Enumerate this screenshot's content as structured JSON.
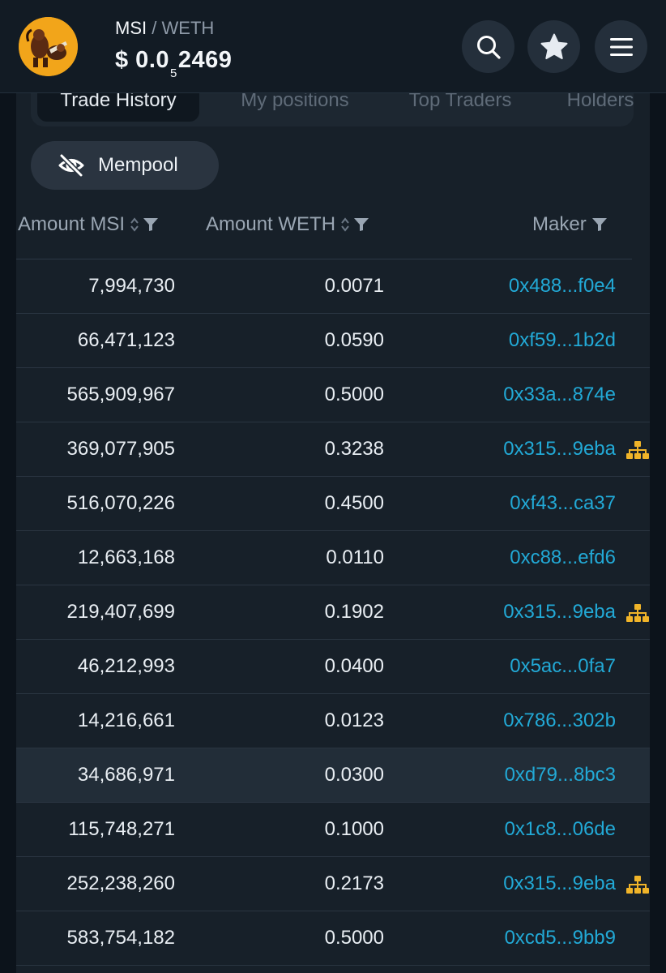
{
  "header": {
    "pair_base": "MSI",
    "pair_sep": "/",
    "pair_quote": "WETH",
    "price_prefix": "$ 0.0",
    "price_zeros": "5",
    "price_digits": "2469"
  },
  "tabs": [
    {
      "label": "Trade History",
      "active": true
    },
    {
      "label": "My positions",
      "active": false
    },
    {
      "label": "Top Traders",
      "active": false
    },
    {
      "label": "Holders",
      "active": false
    }
  ],
  "mempool": {
    "label": "Mempool"
  },
  "columns": {
    "amount_token": "Amount MSI",
    "amount_quote": "Amount WETH",
    "maker": "Maker"
  },
  "rows": [
    {
      "amount_token": "7,994,730",
      "amount_quote": "0.0071",
      "maker": "0x488...f0e4",
      "tree": false
    },
    {
      "amount_token": "66,471,123",
      "amount_quote": "0.0590",
      "maker": "0xf59...1b2d",
      "tree": false
    },
    {
      "amount_token": "565,909,967",
      "amount_quote": "0.5000",
      "maker": "0x33a...874e",
      "tree": false
    },
    {
      "amount_token": "369,077,905",
      "amount_quote": "0.3238",
      "maker": "0x315...9eba",
      "tree": true
    },
    {
      "amount_token": "516,070,226",
      "amount_quote": "0.4500",
      "maker": "0xf43...ca37",
      "tree": false
    },
    {
      "amount_token": "12,663,168",
      "amount_quote": "0.0110",
      "maker": "0xc88...efd6",
      "tree": false
    },
    {
      "amount_token": "219,407,699",
      "amount_quote": "0.1902",
      "maker": "0x315...9eba",
      "tree": true
    },
    {
      "amount_token": "46,212,993",
      "amount_quote": "0.0400",
      "maker": "0x5ac...0fa7",
      "tree": false
    },
    {
      "amount_token": "14,216,661",
      "amount_quote": "0.0123",
      "maker": "0x786...302b",
      "tree": false
    },
    {
      "amount_token": "34,686,971",
      "amount_quote": "0.0300",
      "maker": "0xd79...8bc3",
      "tree": false,
      "highlighted": true
    },
    {
      "amount_token": "115,748,271",
      "amount_quote": "0.1000",
      "maker": "0x1c8...06de",
      "tree": false
    },
    {
      "amount_token": "252,238,260",
      "amount_quote": "0.2173",
      "maker": "0x315...9eba",
      "tree": true
    },
    {
      "amount_token": "583,754,182",
      "amount_quote": "0.5000",
      "maker": "0xcd5...9bb9",
      "tree": false
    }
  ],
  "icons": {
    "search": "search-icon",
    "star": "star-icon",
    "menu": "menu-icon",
    "eye_off": "eye-off-icon",
    "sort": "sort-icon",
    "filter": "filter-icon",
    "tree": "wallet-tree-icon"
  },
  "colors": {
    "maker_link": "#22a9d6",
    "tree_icon": "#f0b429",
    "token_logo": "#f2a51a"
  }
}
